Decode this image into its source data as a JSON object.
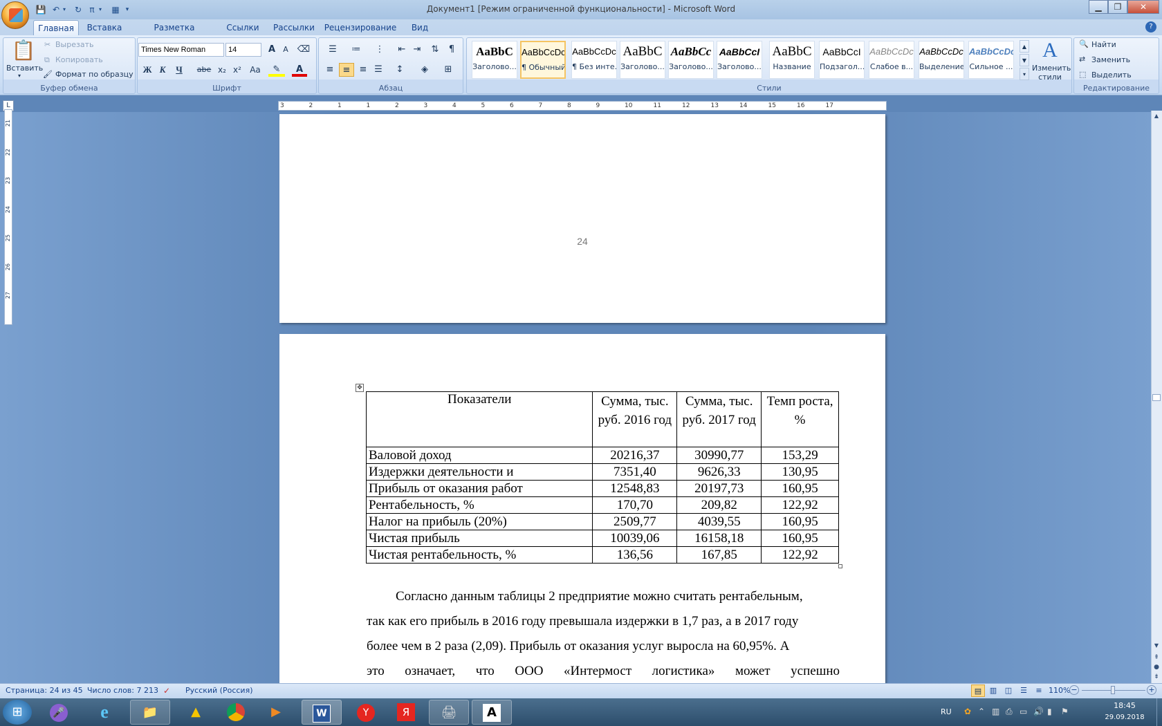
{
  "window": {
    "title": "Документ1 [Режим ограниченной функциональности] - Microsoft Word"
  },
  "tabs": [
    "Главная",
    "Вставка",
    "Разметка страницы",
    "Ссылки",
    "Рассылки",
    "Рецензирование",
    "Вид"
  ],
  "clipboard": {
    "paste": "Вставить",
    "cut": "Вырезать",
    "copy": "Копировать",
    "format_painter": "Формат по образцу",
    "label": "Буфер обмена"
  },
  "font": {
    "name": "Times New Roman",
    "size": "14",
    "label": "Шрифт",
    "bold": "Ж",
    "italic": "К",
    "underline": "Ч",
    "strike": "abe",
    "sub": "x₂",
    "sup": "x²",
    "case": "Aa"
  },
  "paragraph": {
    "label": "Абзац"
  },
  "styles": {
    "label": "Стили",
    "items": [
      {
        "preview": "AaBbC",
        "name": "Заголово..."
      },
      {
        "preview": "AaBbCcDc",
        "name": "¶ Обычный"
      },
      {
        "preview": "AaBbCcDc",
        "name": "¶ Без инте..."
      },
      {
        "preview": "AaBbC",
        "name": "Заголово..."
      },
      {
        "preview": "AaBbCc",
        "name": "Заголово..."
      },
      {
        "preview": "AaBbCcI",
        "name": "Заголово..."
      },
      {
        "preview": "AaBbC",
        "name": "Название"
      },
      {
        "preview": "AaBbCcI",
        "name": "Подзагол..."
      },
      {
        "preview": "AaBbCcDc",
        "name": "Слабое в..."
      },
      {
        "preview": "AaBbCcDc",
        "name": "Выделение"
      },
      {
        "preview": "AaBbCcDc",
        "name": "Сильное ..."
      }
    ],
    "change": "Изменить стили"
  },
  "editing": {
    "find": "Найти",
    "replace": "Заменить",
    "select": "Выделить",
    "label": "Редактирование"
  },
  "ruler": {
    "h_numbers": [
      "3",
      "2",
      "1",
      "1",
      "2",
      "3",
      "4",
      "5",
      "6",
      "7",
      "8",
      "9",
      "10",
      "11",
      "12",
      "13",
      "14",
      "15",
      "16",
      "17"
    ],
    "v_numbers": [
      "21",
      "22",
      "23",
      "24",
      "25",
      "26",
      "27"
    ]
  },
  "document": {
    "page_number": "24",
    "table": {
      "headers": [
        "Показатели",
        "Сумма, тыс. руб. 2016 год",
        "Сумма, тыс. руб. 2017 год",
        "Темп роста, %"
      ],
      "rows": [
        [
          "Валовой доход",
          "20216,37",
          "30990,77",
          "153,29"
        ],
        [
          "Издержки деятельности и",
          "7351,40",
          "9626,33",
          "130,95"
        ],
        [
          "Прибыль от оказания работ",
          "12548,83",
          "20197,73",
          "160,95"
        ],
        [
          "Рентабельность, %",
          "170,70",
          "209,82",
          "122,92"
        ],
        [
          "Налог на прибыль (20%)",
          "2509,77",
          "4039,55",
          "160,95"
        ],
        [
          "Чистая прибыль",
          "10039,06",
          "16158,18",
          "160,95"
        ],
        [
          "Чистая рентабельность, %",
          "136,56",
          "167,85",
          "122,92"
        ]
      ]
    },
    "paragraph_lines": [
      "Согласно данным таблицы 2 предприятие можно считать рентабельным,",
      "так как его прибыль в 2016 году превышала издержки в 1,7 раз, а в 2017 году",
      "более чем в 2 раза (2,09). Прибыль от оказания услуг выросла  на 60,95%. А",
      "это означает, что ООО «Интермост логистика» может успешно"
    ]
  },
  "status": {
    "page": "Страница: 24 из 45",
    "words": "Число слов: 7 213",
    "language": "Русский (Россия)",
    "zoom": "110%"
  },
  "taskbar": {
    "lang": "RU",
    "time": "18:45",
    "date": "29.09.2018"
  }
}
